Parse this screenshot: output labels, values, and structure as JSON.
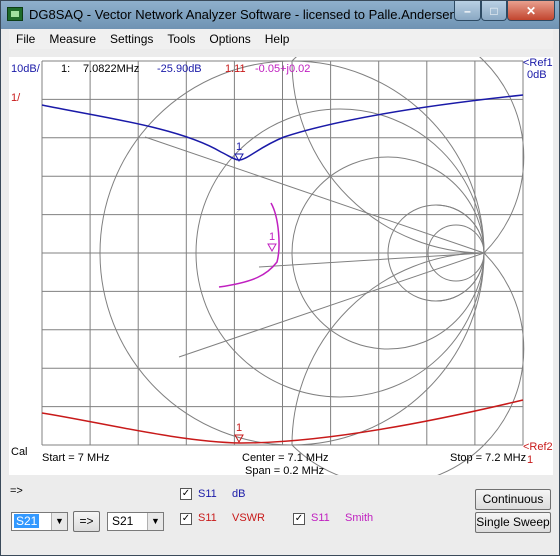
{
  "window": {
    "title": "DG8SAQ  -  Vector Network Analyzer Software  -  licensed to Palle.Andersen",
    "min_glyph": "–",
    "max_glyph": "□",
    "close_glyph": "✕"
  },
  "menu": [
    "File",
    "Measure",
    "Settings",
    "Tools",
    "Options",
    "Help"
  ],
  "plot": {
    "scale_left_top": "10dB/",
    "scale_left_second": "1/",
    "marker_line": {
      "marker": "1:",
      "freq": "7.0822MHz",
      "db": "-25.90dB",
      "vswr": "1.11",
      "smith": "-0.05+j0.02"
    },
    "ref1": "<Ref1",
    "ref1_value": "0dB",
    "ref2": "<Ref2",
    "ref2_value": "1",
    "cal": "Cal",
    "start": "Start = 7 MHz",
    "center": "Center = 7.1 MHz",
    "span": "Span = 0.2 MHz",
    "stop": "Stop = 7.2 MHz",
    "marker_label": "1",
    "colors": {
      "db": "#1a1aa8",
      "vswr": "#c81a1a",
      "smith": "#c020c0",
      "grid": "#808080"
    }
  },
  "controls": {
    "arrow_label": "=>",
    "sel1": "S21",
    "copy_button": "=>",
    "sel2": "S21",
    "traces": [
      {
        "checked": true,
        "param": "S11",
        "format": "dB"
      },
      {
        "checked": true,
        "param": "S11",
        "format": "VSWR"
      },
      {
        "checked": true,
        "param": "S11",
        "format": "Smith"
      }
    ],
    "continuous": "Continuous",
    "single_sweep": "Single Sweep",
    "dropdown_glyph": "▼"
  }
}
